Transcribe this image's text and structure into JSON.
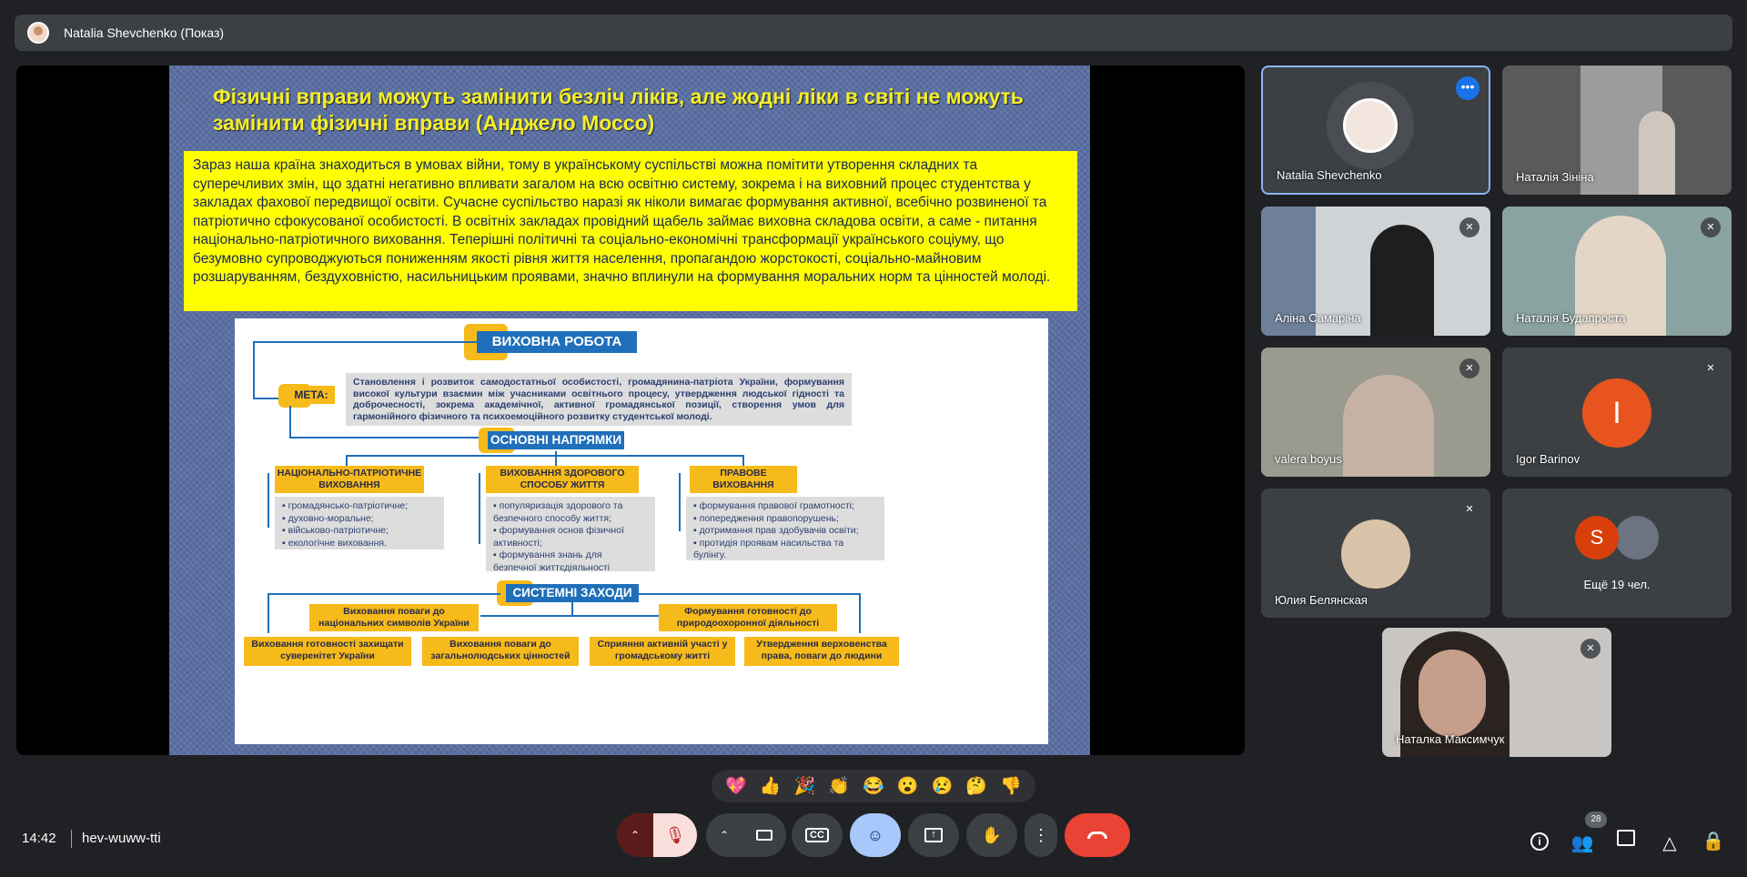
{
  "presenter_bar": {
    "label": "Natalia Shevchenko (Показ)"
  },
  "slide": {
    "title": "Фізичні вправи можуть замінити безліч ліків, але жодні ліки в світі не можуть замінити фізичні вправи (Анджело Моссо)",
    "intro": "Зараз наша країна знаходиться в умовах війни, тому в українському суспільстві можна помітити утворення складних та суперечливих змін, що здатні негативно впливати загалом на всю освітню систему, зокрема і на виховний процес студентства у закладах фахової передвищої освіти. Сучасне суспільство наразі як ніколи вимагає формування активної, всебічно розвиненої та патріотично сфокусованої особистості. В освітніх закладах провідний щабель займає виховна складова освіти, а саме - питання національно-патріотичного виховання. Теперішні політичні та соціально-економічні трансформації українського соціуму, що безумовно супроводжуються пониженням якості рівня життя населення, пропагандою жорстокості, соціально-майновим розшаруванням, бездуховністю, насильницьким проявами, значно вплинули на формування моральних норм та цінностей молоді.",
    "diagram": {
      "main": "ВИХОВНА РОБОТА",
      "meta_label": "МЕТА:",
      "meta_text": "Становлення і розвиток самодостатньої особистості, громадянина-патріота України, формування високої культури взаємин між учасниками освітнього процесу, утвердження людської гідності та доброчесності, зокрема академічної, активної громадянської позиції, створення умов для гармонійного фізичного та психоемоційного розвитку студентської молоді.",
      "directions": "ОСНОВНІ НАПРЯМКИ",
      "col1_title": "НАЦІОНАЛЬНО-ПАТРІОТИЧНЕ ВИХОВАННЯ",
      "col1_items": [
        "громадянсько-патріотичне;",
        "духовно-моральне;",
        "військово-патріотичне;",
        "екологічне виховання."
      ],
      "col2_title": "ВИХОВАННЯ ЗДОРОВОГО СПОСОБУ ЖИТТЯ",
      "col2_items": [
        "популяризація здорового та безпечного способу життя;",
        "формування основ фізичної активності;",
        "формування знань для безпечної життєдіяльності"
      ],
      "col3_title": "ПРАВОВЕ ВИХОВАННЯ",
      "col3_items": [
        "формування правової грамотності;",
        "попередження правопорушень;",
        "дотримання прав здобувачів освіти;",
        "протидія проявам насильства та булінгу."
      ],
      "systemic": "СИСТЕМНІ ЗАХОДИ",
      "s1": "Виховання поваги до національних символів України",
      "s2": "Формування готовності до природоохоронної діяльності",
      "s3": "Виховання готовності захищати суверенітет України",
      "s4": "Виховання поваги до загальнолюдських цінностей",
      "s5": "Сприяння активній участі у громадському житті",
      "s6": "Утвердження верховенства права, поваги до людини"
    }
  },
  "participants": [
    {
      "name": "Natalia Shevchenko"
    },
    {
      "name": "Наталія Зініна"
    },
    {
      "name": "Аліна Самаріна"
    },
    {
      "name": "Наталія Будапроста"
    },
    {
      "name": "valera boyus"
    },
    {
      "name": "Igor Barinov",
      "initial": "I"
    },
    {
      "name": "Юлия Белянская"
    },
    {
      "name": "Ещё 19 чел.",
      "initial": "S"
    },
    {
      "name": "Наталка Максимчук"
    }
  ],
  "reactions": [
    "💖",
    "👍",
    "🎉",
    "👏",
    "😂",
    "😮",
    "😢",
    "🤔",
    "👎"
  ],
  "footer": {
    "time": "14:42",
    "meeting_code": "hev-wuww-tti",
    "people_count": "28"
  },
  "colors": {
    "accent": "#8ab4f8",
    "end_call": "#ea4335",
    "mic_off": "#f9dedc",
    "reactions": "#a8c7fa"
  }
}
